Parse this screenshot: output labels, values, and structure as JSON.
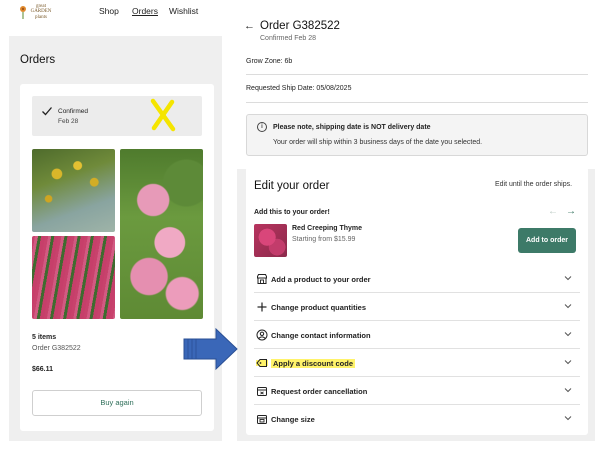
{
  "nav": {
    "logo_text": "great GARDEN plants",
    "links": [
      "Shop",
      "Orders",
      "Wishlist"
    ]
  },
  "left": {
    "title": "Orders",
    "status": {
      "label": "Confirmed",
      "date": "Feb 28"
    },
    "items_count": "5 items",
    "order_number": "Order G382522",
    "total": "$66.11",
    "buy_again": "Buy again"
  },
  "right": {
    "back_icon": "←",
    "title": "Order G382522",
    "confirmed": "Confirmed Feb 28",
    "grow_zone": "Grow Zone: 6b",
    "ship_date": "Requested Ship Date: 05/08/2025",
    "notice": {
      "icon": "i",
      "title": "Please note, shipping date is NOT delivery date",
      "body": "Your order will ship within 3 business days of the date you selected."
    },
    "edit": {
      "title": "Edit your order",
      "until": "Edit until the order ships.",
      "add_this": "Add this to your order!",
      "prev_icon": "←",
      "next_icon": "→",
      "product_name": "Red Creeping Thyme",
      "product_price": "Starting from $15.99",
      "add_button": "Add to order"
    },
    "actions": [
      {
        "label": "Add a product to your order",
        "icon": "storefront-icon",
        "highlight": false
      },
      {
        "label": "Change product quantities",
        "icon": "plus-icon",
        "highlight": false
      },
      {
        "label": "Change contact information",
        "icon": "user-circle-icon",
        "highlight": false
      },
      {
        "label": "Apply a discount code",
        "icon": "tag-icon",
        "highlight": true
      },
      {
        "label": "Request order cancellation",
        "icon": "cancel-box-icon",
        "highlight": false
      },
      {
        "label": "Change size",
        "icon": "resize-box-icon",
        "highlight": false
      }
    ]
  },
  "colors": {
    "accent_green": "#3d7a68",
    "highlight_yellow": "#fff36a",
    "annotation_x_yellow": "#f5e500",
    "annotation_arrow_blue": "#3a67b8"
  }
}
